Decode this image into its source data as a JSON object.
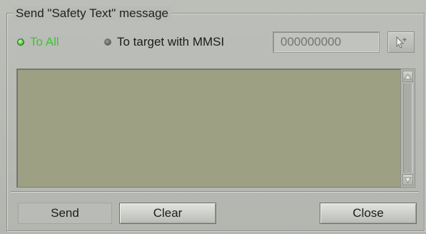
{
  "group": {
    "title": "Send \"Safety Text\" message"
  },
  "recipients": {
    "to_all": {
      "label": "To All",
      "selected": true
    },
    "to_target": {
      "label": "To target with MMSI",
      "selected": false
    },
    "mmsi_placeholder": "000000000"
  },
  "message": {
    "text": ""
  },
  "buttons": {
    "send": "Send",
    "clear": "Clear",
    "close": "Close"
  },
  "icons": {
    "pick_target": "cursor-pick-icon",
    "scroll_up": "arrow-up-icon",
    "scroll_down": "arrow-down-icon"
  },
  "colors": {
    "active_radio_text": "#3fc432",
    "message_background": "#9ea084",
    "panel_background": "#b9bbb6"
  }
}
